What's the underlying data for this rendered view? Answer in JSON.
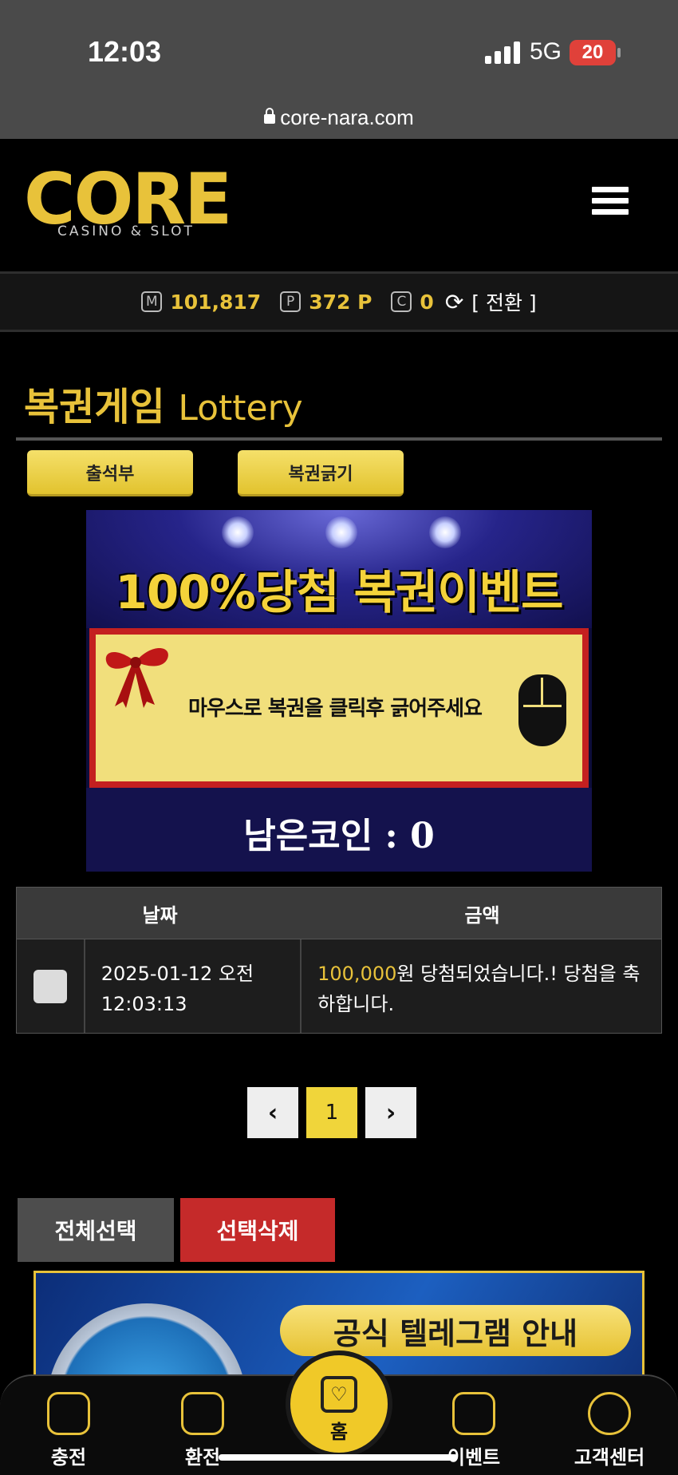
{
  "status": {
    "time": "12:03",
    "network": "5G",
    "battery": "20"
  },
  "browser": {
    "url": "core-nara.com"
  },
  "brand": {
    "logo_text": "CORE",
    "logo_sub": "CASINO & SLOT"
  },
  "balance": {
    "money_icon": "M",
    "money": "101,817",
    "point_icon": "P",
    "point": "372 P",
    "coin_icon": "C",
    "coin": "0",
    "switch_label": "[ 전환 ]"
  },
  "page": {
    "title_ko": "복권게임",
    "title_en": "Lottery",
    "tabs": [
      "출석부",
      "복권긁기"
    ]
  },
  "banner": {
    "headline": "100%당첨 복권이벤트",
    "instruction": "마우스로 복권을 클릭후 긁어주세요",
    "remaining": "남은코인 : 0"
  },
  "table": {
    "headers": [
      "날짜",
      "금액"
    ],
    "rows": [
      {
        "date": "2025-01-12 오전 12:03:13",
        "amount": "100,000",
        "message": "원 당첨되었습니다.! 당첨을 축하합니다."
      }
    ]
  },
  "pagination": {
    "prev": "‹",
    "current": "1",
    "next": "›"
  },
  "actions": {
    "select_all": "전체선택",
    "delete_selected": "선택삭제"
  },
  "promo": {
    "telegram_label": "공식 텔레그램 안내"
  },
  "bottom_nav": {
    "items": [
      "충전",
      "환전",
      "홈",
      "이벤트",
      "고객센터"
    ]
  },
  "colors": {
    "accent": "#e8c23a",
    "danger": "#c52a2a"
  }
}
